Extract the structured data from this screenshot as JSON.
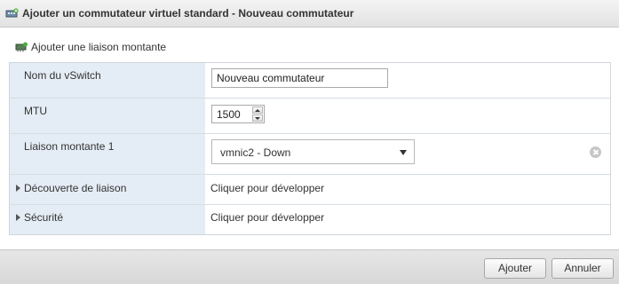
{
  "dialog": {
    "title": "Ajouter un commutateur virtuel standard - Nouveau commutateur",
    "add_uplink_label": "Ajouter une liaison montante"
  },
  "form": {
    "vswitch_name": {
      "label": "Nom du vSwitch",
      "value": "Nouveau commutateur"
    },
    "mtu": {
      "label": "MTU",
      "value": "1500"
    },
    "uplink1": {
      "label": "Liaison montante 1",
      "selected": "vmnic2 - Down"
    },
    "link_discovery": {
      "label": "Découverte de liaison",
      "action": "Cliquer pour développer"
    },
    "security": {
      "label": "Sécurité",
      "action": "Cliquer pour développer"
    }
  },
  "footer": {
    "add_label": "Ajouter",
    "cancel_label": "Annuler"
  },
  "icons": {
    "title_icon": "vswitch-add-icon",
    "uplink_icon": "network-adapter-add-icon",
    "clear_icon": "clear-icon"
  }
}
